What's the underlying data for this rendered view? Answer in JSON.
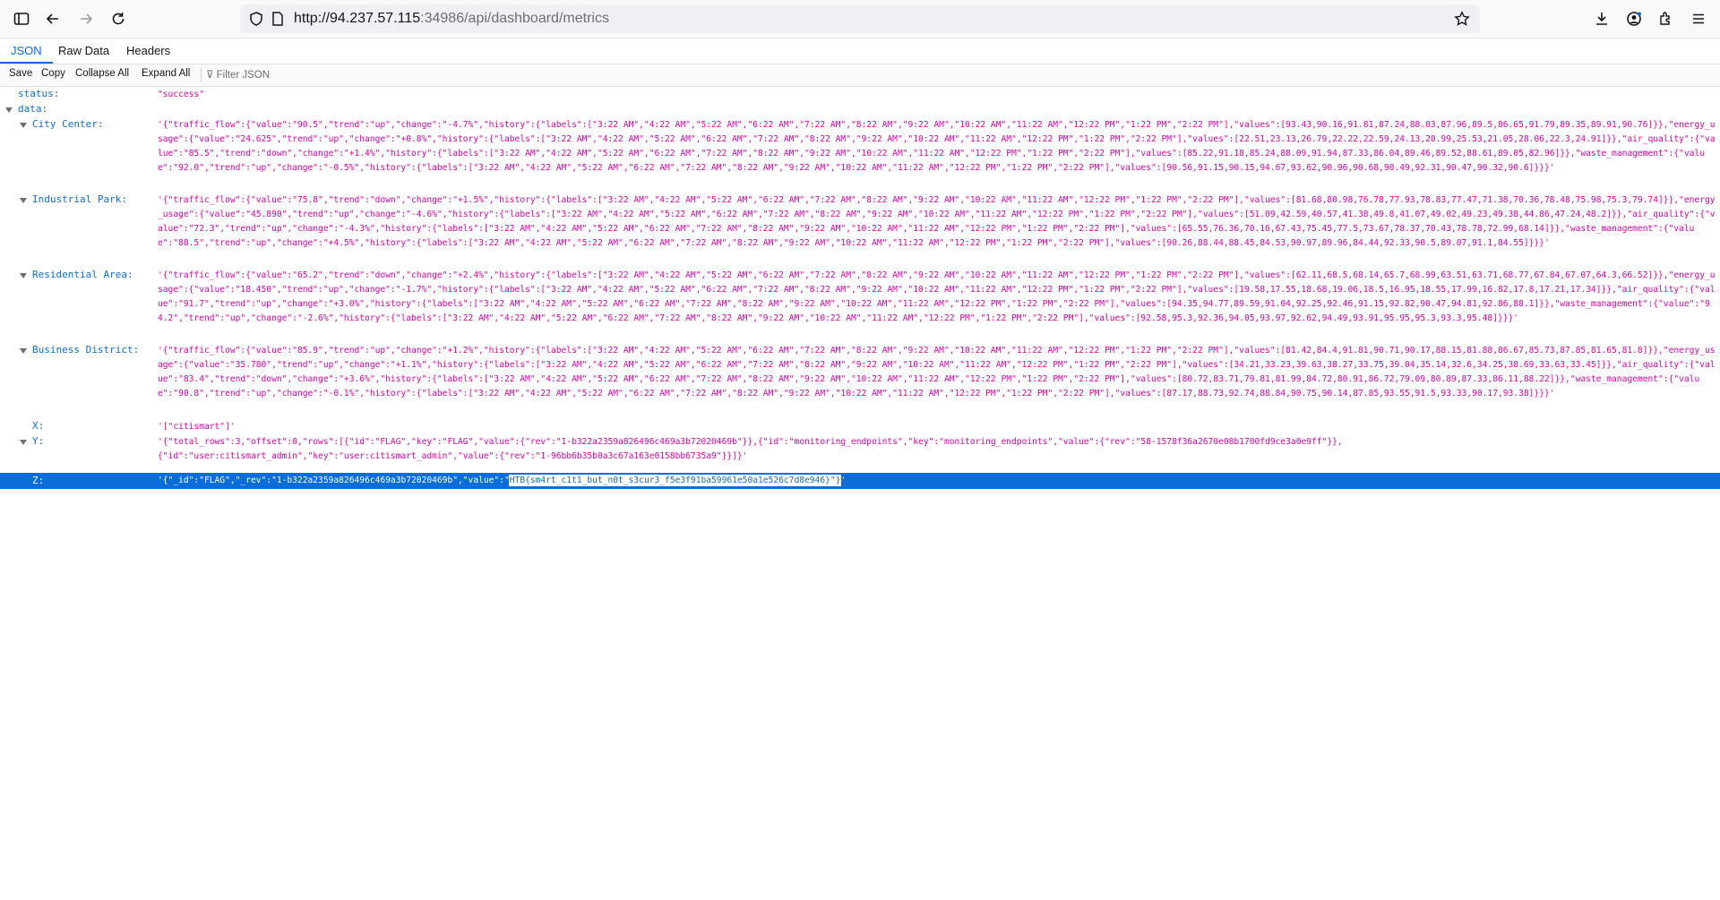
{
  "browser": {
    "url_host": "http://94.237.57.115",
    "url_path": ":34986/api/dashboard/metrics"
  },
  "tabs": [
    {
      "label": "JSON",
      "active": true
    },
    {
      "label": "Raw Data",
      "active": false
    },
    {
      "label": "Headers",
      "active": false
    }
  ],
  "actions": {
    "save": "Save",
    "copy": "Copy",
    "collapse": "Collapse All",
    "expand": "Expand All",
    "filter_placeholder": "Filter JSON"
  },
  "json": {
    "status_key": "status:",
    "status_value": "\"success\"",
    "data_key": "data:",
    "city_key": "City Center:",
    "city_value": "'{\"traffic_flow\":{\"value\":\"90.5\",\"trend\":\"up\",\"change\":\"-4.7%\",\"history\":{\"labels\":[\"3:22 AM\",\"4:22 AM\",\"5:22 AM\",\"6:22 AM\",\"7:22 AM\",\"8:22 AM\",\"9:22 AM\",\"10:22 AM\",\"11:22 AM\",\"12:22 PM\",\"1:22 PM\",\"2:22 PM\"],\"values\":[93.43,90.16,91.81,87.24,88.03,87.96,89.5,86.65,91.79,89.35,89.91,90.76]}},\"energy_usage\":{\"value\":\"24.625\",\"trend\":\"up\",\"change\":\"+0.8%\",\"history\":{\"labels\":[\"3:22 AM\",\"4:22 AM\",\"5:22 AM\",\"6:22 AM\",\"7:22 AM\",\"8:22 AM\",\"9:22 AM\",\"10:22 AM\",\"11:22 AM\",\"12:22 PM\",\"1:22 PM\",\"2:22 PM\"],\"values\":[22.51,23.13,26.79,22.22,22.59,24.13,20.99,25.53,21.05,28.06,22.3,24.91]}},\"air_quality\":{\"value\":\"85.5\",\"trend\":\"down\",\"change\":\"+1.4%\",\"history\":{\"labels\":[\"3:22 AM\",\"4:22 AM\",\"5:22 AM\",\"6:22 AM\",\"7:22 AM\",\"8:22 AM\",\"9:22 AM\",\"10:22 AM\",\"11:22 AM\",\"12:22 PM\",\"1:22 PM\",\"2:22 PM\"],\"values\":[85.22,91.18,85.24,88.09,91.94,87.33,86.04,89.46,89.52,88.61,89.05,82.96]}},\"waste_management\":{\"value\":\"92.0\",\"trend\":\"up\",\"change\":\"-0.5%\",\"history\":{\"labels\":[\"3:22 AM\",\"4:22 AM\",\"5:22 AM\",\"6:22 AM\",\"7:22 AM\",\"8:22 AM\",\"9:22 AM\",\"10:22 AM\",\"11:22 AM\",\"12:22 PM\",\"1:22 PM\",\"2:22 PM\"],\"values\":[90.56,91.15,90.15,94.67,93.62,90.96,90.68,90.49,92.31,90.47,90.32,90.6]}}}'",
    "industrial_key": "Industrial Park:",
    "industrial_value": "'{\"traffic_flow\":{\"value\":\"75.8\",\"trend\":\"down\",\"change\":\"+1.5%\",\"history\":{\"labels\":[\"3:22 AM\",\"4:22 AM\",\"5:22 AM\",\"6:22 AM\",\"7:22 AM\",\"8:22 AM\",\"9:22 AM\",\"10:22 AM\",\"11:22 AM\",\"12:22 PM\",\"1:22 PM\",\"2:22 PM\"],\"values\":[81.68,80.98,76.78,77.93,78.83,77.47,71.38,70.36,78.48,75.98,75.3,79.74]}},\"energy_usage\":{\"value\":\"45.890\",\"trend\":\"up\",\"change\":\"-4.6%\",\"history\":{\"labels\":[\"3:22 AM\",\"4:22 AM\",\"5:22 AM\",\"6:22 AM\",\"7:22 AM\",\"8:22 AM\",\"9:22 AM\",\"10:22 AM\",\"11:22 AM\",\"12:22 PM\",\"1:22 PM\",\"2:22 PM\"],\"values\":[51.09,42.59,40.57,41.38,49.8,41.07,49.02,49.23,49.38,44.86,47.24,48.2]}},\"air_quality\":{\"value\":\"72.3\",\"trend\":\"up\",\"change\":\"-4.3%\",\"history\":{\"labels\":[\"3:22 AM\",\"4:22 AM\",\"5:22 AM\",\"6:22 AM\",\"7:22 AM\",\"8:22 AM\",\"9:22 AM\",\"10:22 AM\",\"11:22 AM\",\"12:22 PM\",\"1:22 PM\",\"2:22 PM\"],\"values\":[65.55,76.36,70.16,67.43,75.45,77.5,73.67,78.37,70.43,78.78,72.99,68.14]}},\"waste_management\":{\"value\":\"88.5\",\"trend\":\"up\",\"change\":\"+4.5%\",\"history\":{\"labels\":[\"3:22 AM\",\"4:22 AM\",\"5:22 AM\",\"6:22 AM\",\"7:22 AM\",\"8:22 AM\",\"9:22 AM\",\"10:22 AM\",\"11:22 AM\",\"12:22 PM\",\"1:22 PM\",\"2:22 PM\"],\"values\":[90.26,88.44,88.45,84.53,90.97,89.96,84.44,92.33,90.5,89.07,91.1,84.55]}}}'",
    "residential_key": "Residential Area:",
    "residential_value": "'{\"traffic_flow\":{\"value\":\"65.2\",\"trend\":\"down\",\"change\":\"+2.4%\",\"history\":{\"labels\":[\"3:22 AM\",\"4:22 AM\",\"5:22 AM\",\"6:22 AM\",\"7:22 AM\",\"8:22 AM\",\"9:22 AM\",\"10:22 AM\",\"11:22 AM\",\"12:22 PM\",\"1:22 PM\",\"2:22 PM\"],\"values\":[62.11,68.5,68.14,65.7,68.99,63.51,63.71,68.77,67.84,67.07,64.3,66.52]}},\"energy_usage\":{\"value\":\"18.450\",\"trend\":\"up\",\"change\":\"-1.7%\",\"history\":{\"labels\":[\"3:22 AM\",\"4:22 AM\",\"5:22 AM\",\"6:22 AM\",\"7:22 AM\",\"8:22 AM\",\"9:22 AM\",\"10:22 AM\",\"11:22 AM\",\"12:22 PM\",\"1:22 PM\",\"2:22 PM\"],\"values\":[19.58,17.55,18.68,19.06,18.5,16.95,18.55,17.99,16.82,17.8,17.21,17.34]}},\"air_quality\":{\"value\":\"91.7\",\"trend\":\"up\",\"change\":\"+3.0%\",\"history\":{\"labels\":[\"3:22 AM\",\"4:22 AM\",\"5:22 AM\",\"6:22 AM\",\"7:22 AM\",\"8:22 AM\",\"9:22 AM\",\"10:22 AM\",\"11:22 AM\",\"12:22 PM\",\"1:22 PM\",\"2:22 PM\"],\"values\":[94.35,94.77,89.59,91.04,92.25,92.46,91.15,92.82,90.47,94.81,92.86,88.1]}},\"waste_management\":{\"value\":\"94.2\",\"trend\":\"up\",\"change\":\"-2.6%\",\"history\":{\"labels\":[\"3:22 AM\",\"4:22 AM\",\"5:22 AM\",\"6:22 AM\",\"7:22 AM\",\"8:22 AM\",\"9:22 AM\",\"10:22 AM\",\"11:22 AM\",\"12:22 PM\",\"1:22 PM\",\"2:22 PM\"],\"values\":[92.58,95.3,92.36,94.05,93.97,92.62,94.49,93.91,95.95,95.3,93.3,95.48]}}}'",
    "business_key": "Business District:",
    "business_value": "'{\"traffic_flow\":{\"value\":\"85.9\",\"trend\":\"up\",\"change\":\"+1.2%\",\"history\":{\"labels\":[\"3:22 AM\",\"4:22 AM\",\"5:22 AM\",\"6:22 AM\",\"7:22 AM\",\"8:22 AM\",\"9:22 AM\",\"10:22 AM\",\"11:22 AM\",\"12:22 PM\",\"1:22 PM\",\"2:22 PM\"],\"values\":[81.42,84.4,91.81,90.71,90.17,88.15,81.88,86.67,85.73,87.85,81.65,81.8]}},\"energy_usage\":{\"value\":\"35.780\",\"trend\":\"up\",\"change\":\"+1.1%\",\"history\":{\"labels\":[\"3:22 AM\",\"4:22 AM\",\"5:22 AM\",\"6:22 AM\",\"7:22 AM\",\"8:22 AM\",\"9:22 AM\",\"10:22 AM\",\"11:22 AM\",\"12:22 PM\",\"1:22 PM\",\"2:22 PM\"],\"values\":[34.21,33.23,39.63,38.27,33.75,39.04,35.14,32.6,34.25,38.69,33.63,33.45]}},\"air_quality\":{\"value\":\"83.4\",\"trend\":\"down\",\"change\":\"+3.6%\",\"history\":{\"labels\":[\"3:22 AM\",\"4:22 AM\",\"5:22 AM\",\"6:22 AM\",\"7:22 AM\",\"8:22 AM\",\"9:22 AM\",\"10:22 AM\",\"11:22 AM\",\"12:22 PM\",\"1:22 PM\",\"2:22 PM\"],\"values\":[80.72,83.71,79.81,81.99,84.72,80.91,86.72,79.09,80.89,87.33,86.11,88.22]}},\"waste_management\":{\"value\":\"90.8\",\"trend\":\"up\",\"change\":\"-0.1%\",\"history\":{\"labels\":[\"3:22 AM\",\"4:22 AM\",\"5:22 AM\",\"6:22 AM\",\"7:22 AM\",\"8:22 AM\",\"9:22 AM\",\"10:22 AM\",\"11:22 AM\",\"12:22 PM\",\"1:22 PM\",\"2:22 PM\"],\"values\":[87.17,88.73,92.74,88.84,90.75,90.14,87.85,93.55,91.5,93.33,90.17,93.38]}}}'",
    "x_key": "X:",
    "x_value": "'[\"citismart\"]'",
    "y_key": "Y:",
    "y_value": "'{\"total_rows\":3,\"offset\":0,\"rows\":[{\"id\":\"FLAG\",\"key\":\"FLAG\",\"value\":{\"rev\":\"1-b322a2359a826496c469a3b72020469b\"}},{\"id\":\"monitoring_endpoints\",\"key\":\"monitoring_endpoints\",\"value\":{\"rev\":\"58-1578f36a2670e08b1700fd9ce3a0e9ff\"}},\n{\"id\":\"user:citismart_admin\",\"key\":\"user:citismart_admin\",\"value\":{\"rev\":\"1-96bb6b35b0a3c67a163e0158bb6735a9\"}}]}'",
    "z_key": "Z:",
    "z_prefix": "'{\"_id\":\"FLAG\",\"_rev\":\"1-b322a2359a826496c469a3b72020469b\",\"value\":\"",
    "z_highlight": "HTB{sm4rt_c1t1_but_n0t_s3cur3_f5e3f91ba59961e50a1e526c7d8e946}\"}",
    "z_suffix": "'"
  }
}
